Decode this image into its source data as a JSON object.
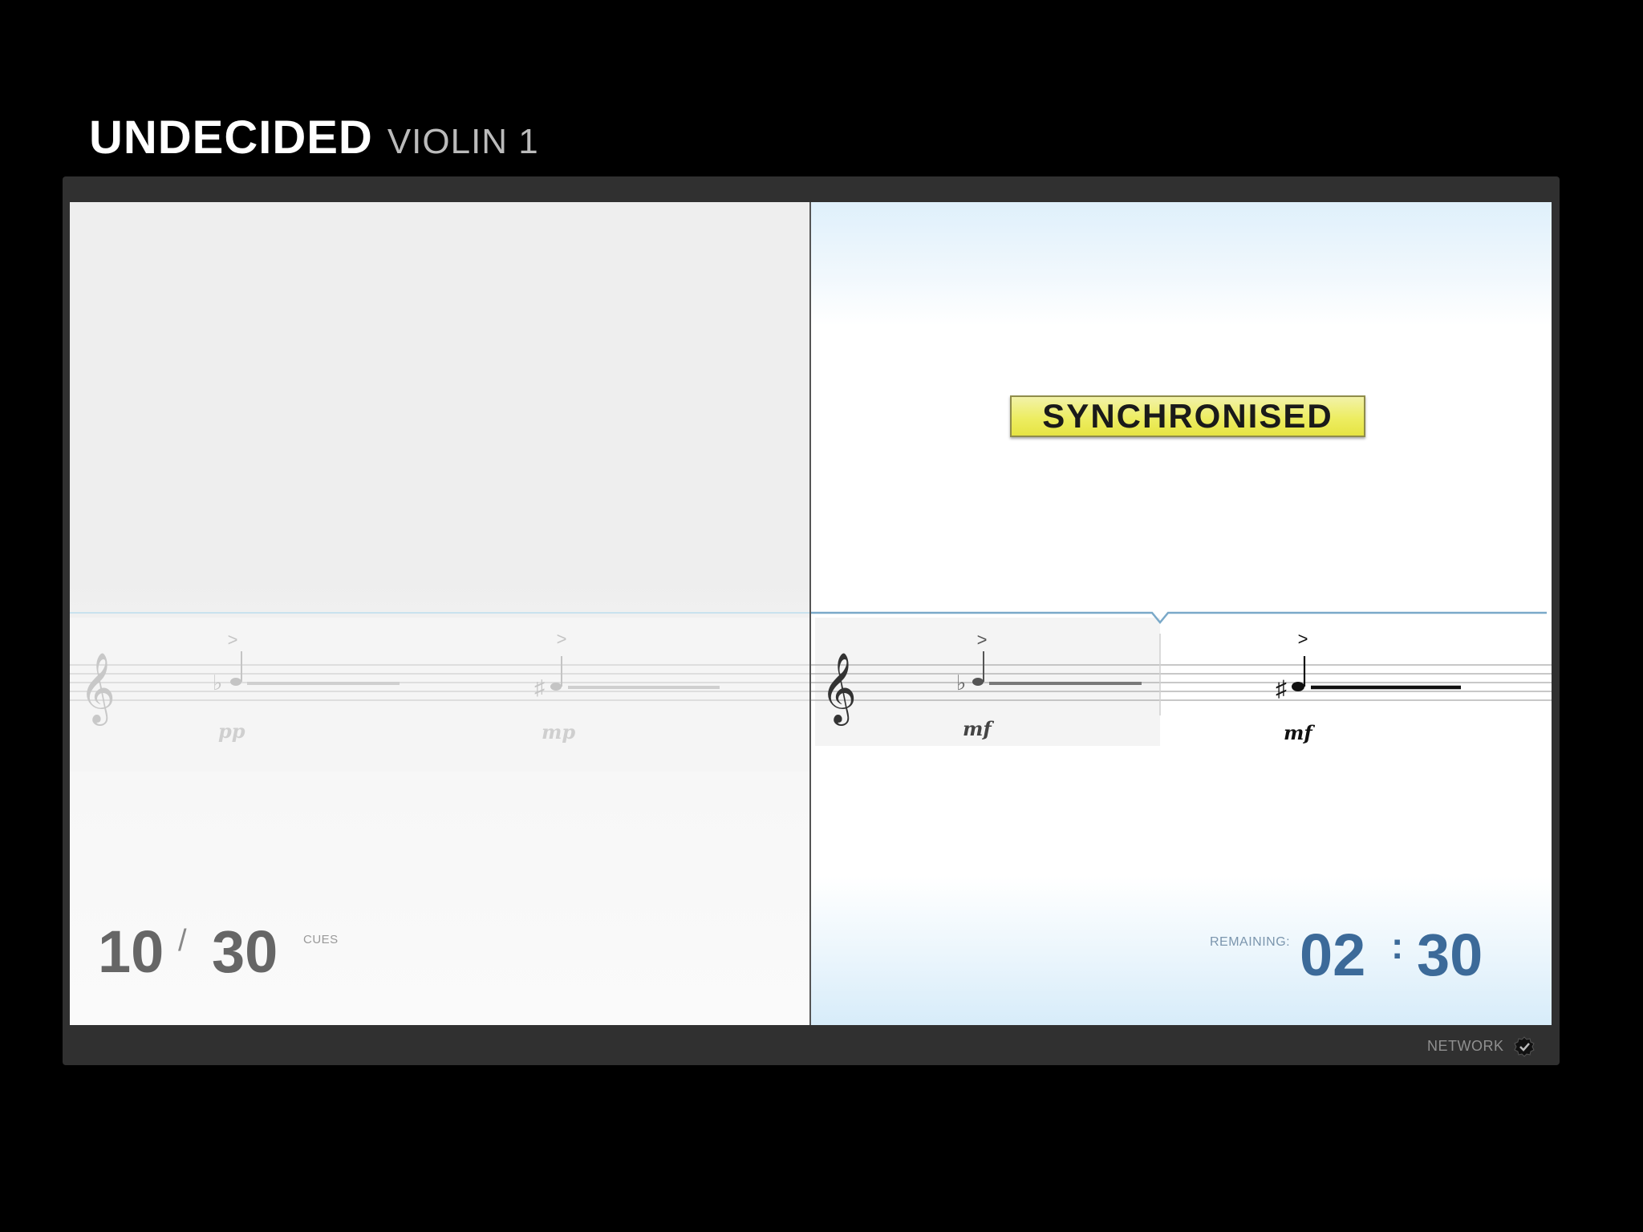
{
  "header": {
    "piece_title": "UNDECIDED",
    "part_name": "VIOLIN 1"
  },
  "status": {
    "sync_label": "SYNCHRONISED"
  },
  "cues": {
    "current": "10",
    "separator": "/",
    "total": "30",
    "label": "CUES"
  },
  "timer": {
    "label": "REMAINING:",
    "minutes": "02",
    "separator": ":",
    "seconds": "30"
  },
  "footer": {
    "network_label": "NETWORK",
    "network_icon": "check-badge-icon"
  },
  "score": {
    "clef_glyph": "𝄞",
    "dynamics": [
      "pp",
      "mp",
      "mf",
      "mf"
    ],
    "accidentals": [
      "♭",
      "♯",
      "♭",
      "♯"
    ],
    "accent_glyph": ">"
  },
  "colors": {
    "badge_yellow": "#eded62",
    "timer_blue": "#3c6a99",
    "cue_grey": "#666666"
  }
}
